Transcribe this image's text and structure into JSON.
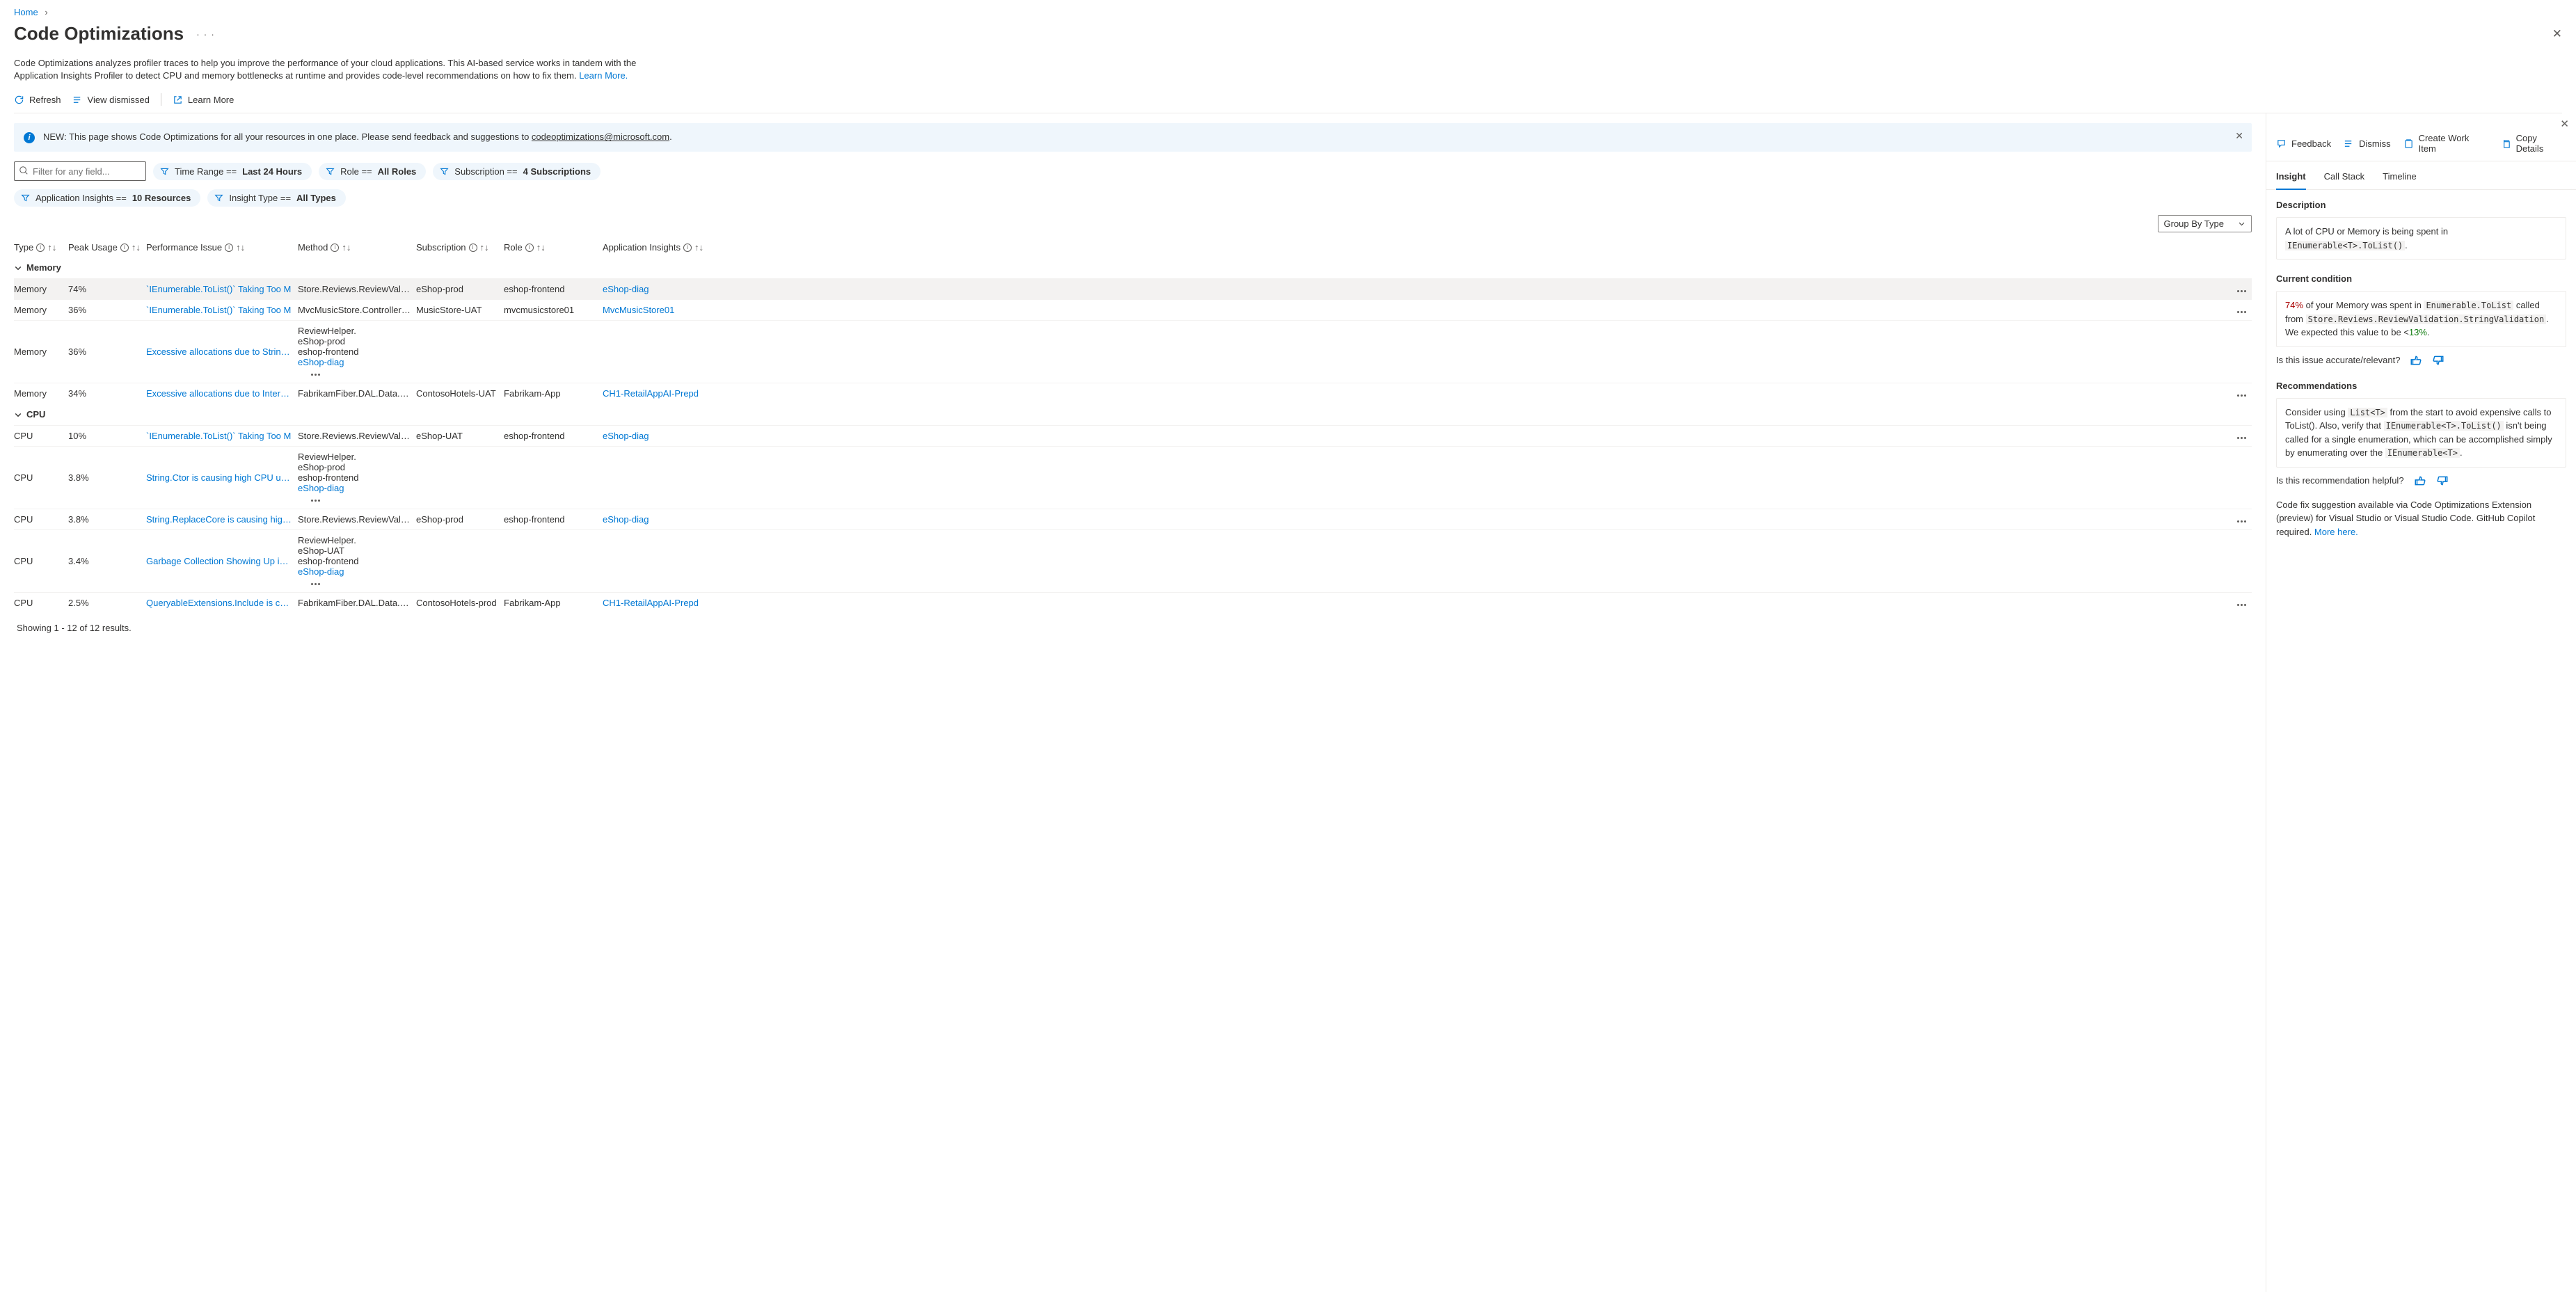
{
  "breadcrumb": {
    "home": "Home"
  },
  "header": {
    "title": "Code Optimizations"
  },
  "description": {
    "text": "Code Optimizations analyzes profiler traces to help you improve the performance of your cloud applications. This AI-based service works in tandem with the Application Insights Profiler to detect CPU and memory bottlenecks at runtime and provides code-level recommendations on how to fix them.",
    "learn_more": "Learn More."
  },
  "toolbar": {
    "refresh": "Refresh",
    "view_dismissed": "View dismissed",
    "learn_more": "Learn More"
  },
  "banner": {
    "prefix": "NEW: This page shows Code Optimizations for all your resources in one place. Please send feedback and suggestions to ",
    "email": "codeoptimizations@microsoft.com",
    "suffix": "."
  },
  "filters": {
    "placeholder": "Filter for any field...",
    "time_label": "Time Range ==",
    "time_value": "Last 24 Hours",
    "role_label": "Role ==",
    "role_value": "All Roles",
    "sub_label": "Subscription ==",
    "sub_value": "4 Subscriptions",
    "ai_label": "Application Insights ==",
    "ai_value": "10 Resources",
    "type_label": "Insight Type ==",
    "type_value": "All Types"
  },
  "groupby": {
    "label": "Group By Type"
  },
  "columns": {
    "type": "Type",
    "peak": "Peak Usage",
    "issue": "Performance Issue",
    "method": "Method",
    "subscription": "Subscription",
    "role": "Role",
    "appinsights": "Application Insights"
  },
  "groups": {
    "memory": "Memory",
    "cpu": "CPU"
  },
  "rows_memory": [
    {
      "type": "Memory",
      "peak": "74%",
      "issue": "`IEnumerable<T>.ToList()` Taking Too M",
      "method": "Store.Reviews.ReviewValidatio",
      "sub": "eShop-prod",
      "role": "eshop-frontend",
      "app": "eShop-diag",
      "selected": true
    },
    {
      "type": "Memory",
      "peak": "36%",
      "issue": "`IEnumerable<T>.ToList()` Taking Too M",
      "method": "MvcMusicStore.Controllers.Stc",
      "sub": "MusicStore-UAT",
      "role": "mvcmusicstore01",
      "app": "MvcMusicStore01"
    },
    {
      "type": "Memory",
      "peak": "36%",
      "issue": "Excessive allocations due to String.Ctor",
      "method": "ReviewHelper.<LoadDisallowe",
      "sub": "eShop-prod",
      "role": "eshop-frontend",
      "app": "eShop-diag"
    },
    {
      "type": "Memory",
      "peak": "34%",
      "issue": "Excessive allocations due to InternalSet",
      "method": "FabrikamFiber.DAL.Data.Custc",
      "sub": "ContosoHotels-UAT",
      "role": "Fabrikam-App",
      "app": "CH1-RetailAppAI-Prepd"
    }
  ],
  "rows_cpu": [
    {
      "type": "CPU",
      "peak": "10%",
      "issue": "`IEnumerable<T>.ToList()` Taking Too M",
      "method": "Store.Reviews.ReviewValidatio",
      "sub": "eShop-UAT",
      "role": "eshop-frontend",
      "app": "eShop-diag"
    },
    {
      "type": "CPU",
      "peak": "3.8%",
      "issue": "String.Ctor is causing high CPU usage",
      "method": "ReviewHelper.<LoadDisallowe",
      "sub": "eShop-prod",
      "role": "eshop-frontend",
      "app": "eShop-diag"
    },
    {
      "type": "CPU",
      "peak": "3.8%",
      "issue": "String.ReplaceCore is causing high CPU",
      "method": "Store.Reviews.ReviewValidatio",
      "sub": "eShop-prod",
      "role": "eshop-frontend",
      "app": "eShop-diag"
    },
    {
      "type": "CPU",
      "peak": "3.4%",
      "issue": "Garbage Collection Showing Up in CPU",
      "method": "ReviewHelper.<LoadDisallowe",
      "sub": "eShop-UAT",
      "role": "eshop-frontend",
      "app": "eShop-diag"
    },
    {
      "type": "CPU",
      "peak": "2.5%",
      "issue": "QueryableExtensions.Include is causing",
      "method": "FabrikamFiber.DAL.Data.Servic",
      "sub": "ContosoHotels-prod",
      "role": "Fabrikam-App",
      "app": "CH1-RetailAppAI-Prepd"
    }
  ],
  "pager": "Showing 1 - 12 of 12 results.",
  "panel": {
    "feedback": "Feedback",
    "dismiss": "Dismiss",
    "create": "Create Work Item",
    "copy": "Copy Details",
    "tabs": {
      "insight": "Insight",
      "callstack": "Call Stack",
      "timeline": "Timeline"
    },
    "desc_title": "Description",
    "desc_text": "A lot of CPU or Memory is being spent in ",
    "desc_code": "IEnumerable<T>.ToList()",
    "cond_title": "Current condition",
    "cond_pct": "74%",
    "cond_text1": " of your Memory was spent in ",
    "cond_code1": "Enumerable.ToList",
    "cond_text2": " called from ",
    "cond_code2": "Store.Reviews.ReviewValidation.StringValidation",
    "cond_text3": ". We expected this value to be <",
    "cond_pct2": "13%",
    "cond_text4": ".",
    "issue_q": "Is this issue accurate/relevant?",
    "rec_title": "Recommendations",
    "rec_text1": "Consider using ",
    "rec_code1": "List<T>",
    "rec_text2": " from the start to avoid expensive calls to ToList(). Also, verify that ",
    "rec_code2": "IEnumerable<T>.ToList()",
    "rec_text3": " isn't being called for a single enumeration, which can be accomplished simply by enumerating over the ",
    "rec_code3": "IEnumerable<T>",
    "rec_text4": ".",
    "rec_q": "Is this recommendation helpful?",
    "foot_text": "Code fix suggestion available via Code Optimizations Extension (preview) for Visual Studio or Visual Studio Code. GitHub Copilot required. ",
    "foot_link": "More here."
  }
}
